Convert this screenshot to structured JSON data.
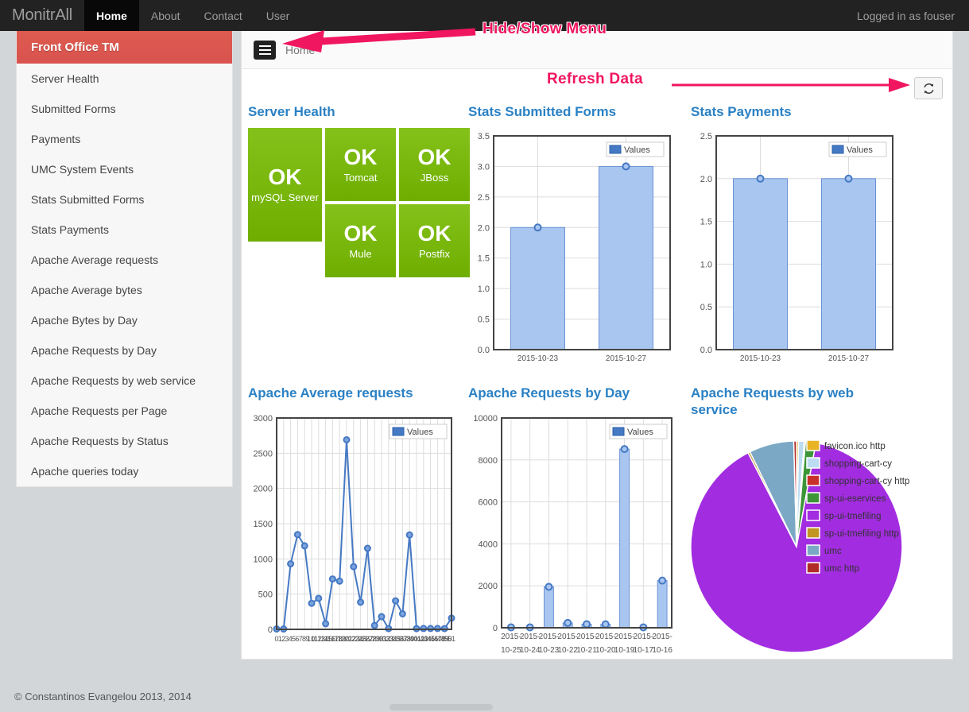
{
  "navbar": {
    "brand": "MonitrAll",
    "links": [
      {
        "label": "Home",
        "active": true
      },
      {
        "label": "About",
        "active": false
      },
      {
        "label": "Contact",
        "active": false
      },
      {
        "label": "User",
        "active": false
      }
    ],
    "user_status": "Logged in as fouser"
  },
  "sidebar": {
    "header": "Front Office TM",
    "items": [
      {
        "label": "Server Health"
      },
      {
        "label": "Submitted Forms"
      },
      {
        "label": "Payments"
      },
      {
        "label": "UMC System Events"
      },
      {
        "label": "Stats Submitted Forms"
      },
      {
        "label": "Stats Payments"
      },
      {
        "label": "Apache Average requests"
      },
      {
        "label": "Apache Average bytes"
      },
      {
        "label": "Apache Bytes by Day"
      },
      {
        "label": "Apache Requests by Day"
      },
      {
        "label": "Apache Requests by web service"
      },
      {
        "label": "Apache Requests per Page"
      },
      {
        "label": "Apache Requests by Status"
      },
      {
        "label": "Apache queries today"
      }
    ]
  },
  "content": {
    "breadcrumb": "Home",
    "menu_toggle_icon": "hamburger-icon",
    "refresh_icon": "refresh-icon"
  },
  "annotations": [
    {
      "text": "Hide/Show Menu",
      "color": "#f0165f"
    },
    {
      "text": "Refresh Data",
      "color": "#f0165f"
    }
  ],
  "server_health": {
    "title": "Server Health",
    "tiles": [
      {
        "status": "OK",
        "name": "mySQL Server",
        "color": "#76b900"
      },
      {
        "status": "OK",
        "name": "Tomcat",
        "color": "#76b900"
      },
      {
        "status": "OK",
        "name": "JBoss",
        "color": "#76b900"
      },
      {
        "status": "OK",
        "name": "Mule",
        "color": "#76b900"
      },
      {
        "status": "OK",
        "name": "Postfix",
        "color": "#76b900"
      }
    ]
  },
  "footer": {
    "text": "© Constantinos Evangelou 2013, 2014"
  },
  "chart_data": [
    {
      "id": "stats-submitted-forms",
      "type": "bar",
      "title": "Stats Submitted Forms",
      "categories": [
        "2015-10-23",
        "2015-10-27"
      ],
      "values": [
        2.0,
        3.0
      ],
      "legend": [
        "Values"
      ],
      "legend_position": "top-right",
      "ylim": [
        0.0,
        3.5
      ],
      "yticks": [
        "0.0",
        "0.5",
        "1.0",
        "1.5",
        "2.0",
        "2.5",
        "3.0",
        "3.5"
      ],
      "grid": true,
      "xlabel": "",
      "ylabel": "",
      "series_color": "#a8c6f0",
      "marker_color": "#4679c4"
    },
    {
      "id": "stats-payments",
      "type": "bar",
      "title": "Stats Payments",
      "categories": [
        "2015-10-23",
        "2015-10-27"
      ],
      "values": [
        2.0,
        2.0
      ],
      "legend": [
        "Values"
      ],
      "legend_position": "top-right",
      "ylim": [
        0.0,
        2.5
      ],
      "yticks": [
        "0.0",
        "0.5",
        "1.0",
        "1.5",
        "2.0",
        "2.5"
      ],
      "grid": true,
      "xlabel": "",
      "ylabel": "",
      "series_color": "#a8c6f0",
      "marker_color": "#4679c4"
    },
    {
      "id": "apache-average-requests",
      "type": "line",
      "title": "Apache Average requests",
      "legend": [
        "Values"
      ],
      "legend_position": "top-right",
      "ylim": [
        0,
        3000
      ],
      "yticks": [
        "0",
        "500",
        "1000",
        "1500",
        "2000",
        "2500",
        "3000"
      ],
      "grid": true,
      "xlabel": "",
      "ylabel": "",
      "xtick_note": "hour labels 0-23 overlapping / illegible",
      "values": [
        5,
        5,
        930,
        1345,
        1185,
        370,
        440,
        80,
        715,
        685,
        2690,
        890,
        385,
        1150,
        55,
        180,
        10,
        405,
        220,
        1340,
        10,
        12,
        12,
        12,
        10,
        160
      ],
      "series_color": "#4679c4",
      "marker_color": "#4679c4"
    },
    {
      "id": "apache-requests-by-day",
      "type": "bar",
      "title": "Apache Requests by Day",
      "categories": [
        "2015-10-25",
        "2015-10-24",
        "2015-10-23",
        "2015-10-22",
        "2015-10-21",
        "2015-10-20",
        "2015-10-19",
        "2015-10-17",
        "2015-10-16"
      ],
      "values": [
        20,
        20,
        1950,
        230,
        170,
        165,
        8520,
        20,
        2250
      ],
      "legend": [
        "Values"
      ],
      "legend_position": "top-right",
      "ylim": [
        0,
        10000
      ],
      "yticks": [
        "0",
        "2000",
        "4000",
        "6000",
        "8000",
        "10000"
      ],
      "grid": true,
      "xlabel": "",
      "ylabel": "",
      "series_color": "#a8c6f0",
      "marker_color": "#4679c4"
    },
    {
      "id": "apache-requests-by-web-service",
      "type": "pie",
      "title": "Apache Requests by web service",
      "legend_position": "right",
      "labels": [
        "favicon.ico http",
        "shopping-cart-cy",
        "shopping-cart-cy http",
        "sp-ui-eservices",
        "sp-ui-tmefiling",
        "sp-ui-tmefiling http",
        "umc",
        "umc http"
      ],
      "colors": [
        "#e8b325",
        "#bcdcf2",
        "#c9302c",
        "#3c9638",
        "#a22ce0",
        "#c09520",
        "#7ba8c4",
        "#b02c28"
      ],
      "values": [
        0.3,
        0.8,
        0.2,
        1.5,
        85.0,
        0.3,
        6.5,
        0.4
      ]
    }
  ]
}
